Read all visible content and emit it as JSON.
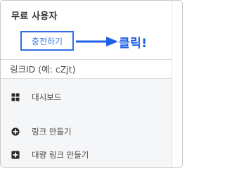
{
  "user": {
    "type_label": "무료 사용자",
    "charge_button_label": "충전하기"
  },
  "annotation": {
    "callout_text": "클릭!",
    "arrow_color": "#1d5fe6"
  },
  "link_search": {
    "placeholder": "링크ID (예: cZjt)",
    "value": ""
  },
  "menu": {
    "items": [
      {
        "icon": "dashboard-grid-icon",
        "label": "대시보드"
      },
      {
        "icon": "plus-circle-icon",
        "label": "링크 만들기"
      },
      {
        "icon": "plus-square-icon",
        "label": "대량 링크 만들기"
      }
    ]
  },
  "colors": {
    "accent": "#2f6fe4",
    "menu_background": "#f5f6f8",
    "icon": "#2b2b2b"
  }
}
